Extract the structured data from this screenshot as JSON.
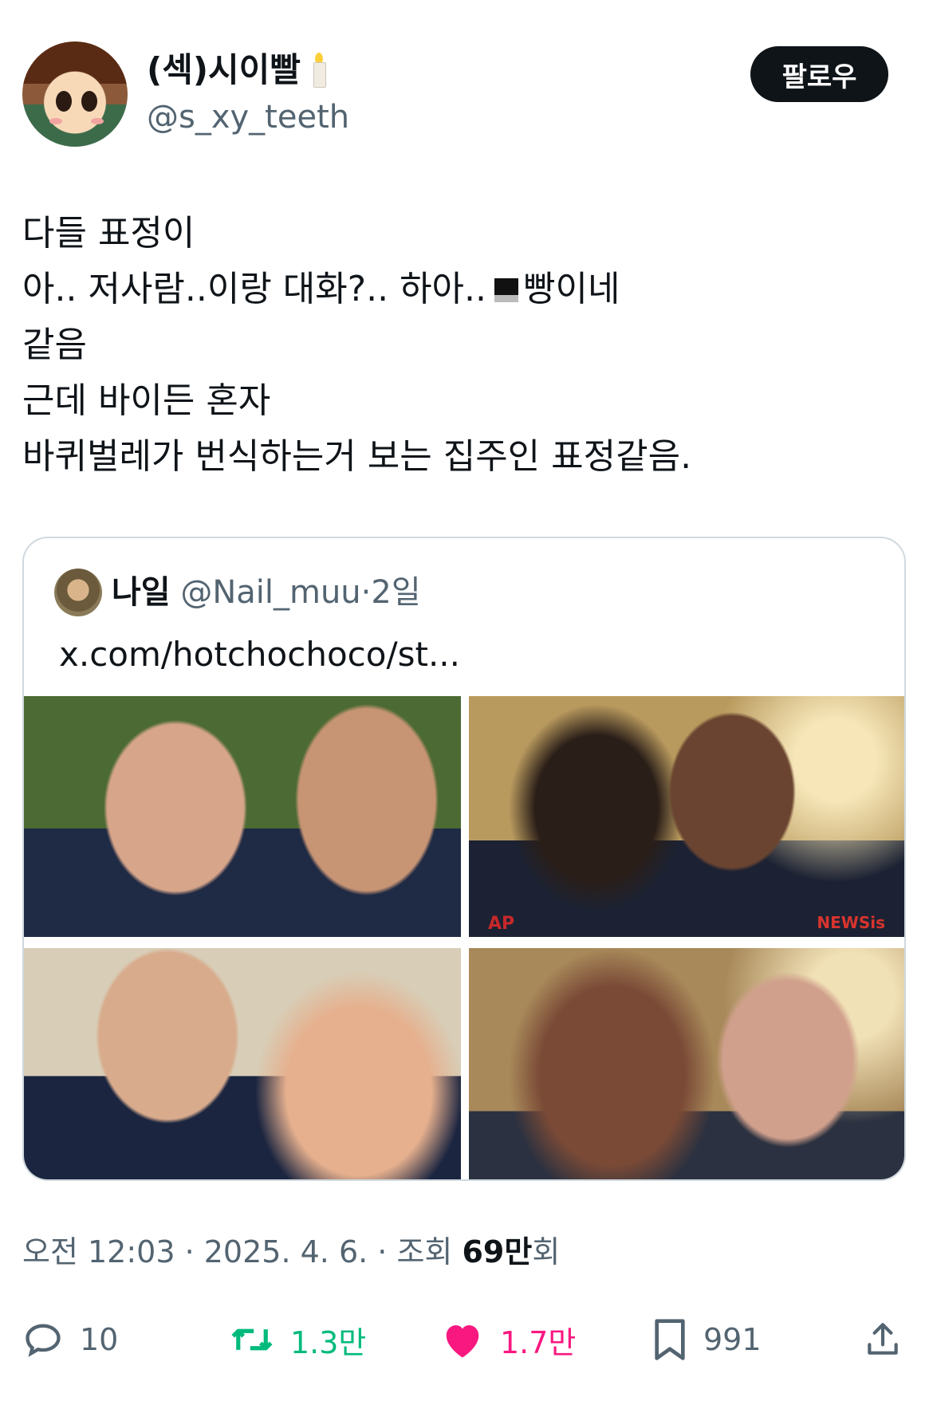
{
  "author": {
    "display_name": "(섹)시이빨",
    "handle": "@s_xy_teeth",
    "avatar_icon": "anime-character-avatar",
    "name_emoji": "candle-emoji"
  },
  "follow_label": "팔로우",
  "tweet_lines": [
    "다들 표정이",
    "아.. 저사람..이랑 대화?.. 하아..",
    "빵이네",
    "같음",
    "근데 바이든 혼자",
    "바퀴벌레가 번식하는거 보는 집주인 표정같음."
  ],
  "quote": {
    "name": "나일",
    "handle": "@Nail_muu",
    "age": "2일",
    "link": "x.com/hotchochoco/st...",
    "watermark_p2": "NEWSis",
    "ap_mark": "AP"
  },
  "timestamp": {
    "time_date": "오전 12:03 · 2025. 4. 6. · 조회",
    "views_bold": "69만",
    "views_suffix": "회"
  },
  "actions": {
    "replies": "10",
    "retweets": "1.3만",
    "likes": "1.7만",
    "bookmarks": "991"
  },
  "colors": {
    "text": "#0f1419",
    "secondary": "#536471",
    "retweet": "#00ba7c",
    "like": "#f91880"
  }
}
